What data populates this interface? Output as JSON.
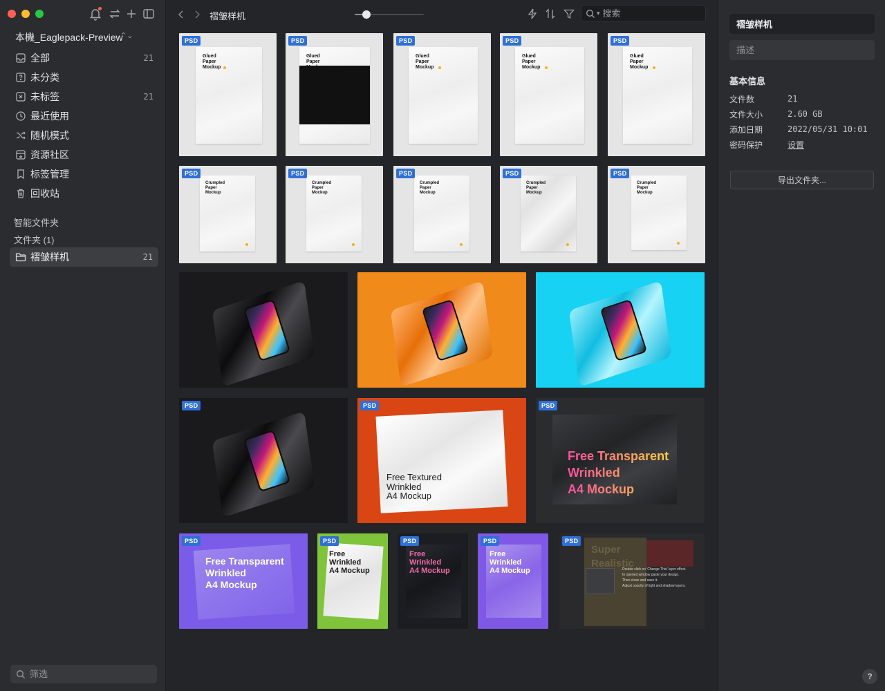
{
  "sidebar": {
    "library_name": "本機_Eaglepack-Preview",
    "nav": [
      {
        "label": "全部",
        "count": "21",
        "icon": "inbox-icon"
      },
      {
        "label": "未分类",
        "count": "",
        "icon": "question-box-icon"
      },
      {
        "label": "未标签",
        "count": "21",
        "icon": "untagged-icon"
      },
      {
        "label": "最近使用",
        "count": "",
        "icon": "clock-icon"
      },
      {
        "label": "随机模式",
        "count": "",
        "icon": "shuffle-icon"
      },
      {
        "label": "资源社区",
        "count": "",
        "icon": "community-icon"
      },
      {
        "label": "标签管理",
        "count": "",
        "icon": "bookmark-icon"
      },
      {
        "label": "回收站",
        "count": "",
        "icon": "trash-icon"
      }
    ],
    "smart_folders_label": "智能文件夹",
    "folders_label": "文件夹 (1)",
    "folder": {
      "label": "褶皱样机",
      "count": "21"
    },
    "filter_placeholder": "筛选"
  },
  "toolbar": {
    "folder_title": "褶皱样机",
    "zoom_fraction": 0.17,
    "search_placeholder": "搜索"
  },
  "grid": {
    "badge_label": "PSD",
    "row1": [
      {
        "title": "Glued\nPaper\nMockup",
        "variant": "white"
      },
      {
        "title": "Glued\nPaper\nMockup",
        "variant": "black"
      },
      {
        "title": "Glued\nPaper\nMockup",
        "variant": "white"
      },
      {
        "title": "Glued\nPaper\nMockup",
        "variant": "white"
      },
      {
        "title": "Glued\nPaper\nMockup",
        "variant": "white"
      }
    ],
    "row2": [
      {
        "title": "Crumpled\nPaper\nMockup"
      },
      {
        "title": "Crumpled\nPaper\nMockup"
      },
      {
        "title": "Crumpled\nPaper\nMockup"
      },
      {
        "title": "Crumpled\nPaper\nMockup"
      },
      {
        "title": "Crumpled\nPaper\nMockup"
      }
    ],
    "row4_textured": "Free Textured\nWrinkled\nA4 Mockup",
    "row4_transparent": "Free Transparent\nWrinkled\nA4 Mockup",
    "row5_purple": "Free Transparent\nWrinkled\nA4 Mockup",
    "row5_green": "Free\nWrinkled\nA4 Mockup",
    "row5_dark": "Free\nWrinkled\nA4 Mockup",
    "row5_violet": "Free\nWrinkled\nA4 Mockup",
    "row5_super": "Super\nRealistic",
    "row5_note": "Double click on 'Change This' layer effect.\nIn opened window paste your design.\nThen close and save it.\nAdjust opacity of light and shadow layers.",
    "scene_colors": {
      "black": "#1a1a1c",
      "orange": "#f08a1b",
      "cyan": "#17d2f2",
      "red": "#d94614",
      "charcoal": "#2b2c2e",
      "purple": "#7a5ce8",
      "green": "#7fc43a",
      "violet": "#7f58e6"
    }
  },
  "inspector": {
    "folder_name": "褶皱样机",
    "description_placeholder": "描述",
    "section_title": "基本信息",
    "rows": [
      {
        "label": "文件数",
        "value": "21"
      },
      {
        "label": "文件大小",
        "value": "2.60 GB"
      },
      {
        "label": "添加日期",
        "value": "2022/05/31 10:01"
      },
      {
        "label": "密码保护",
        "value": "设置"
      }
    ],
    "export_label": "导出文件夹...",
    "help_label": "?"
  }
}
